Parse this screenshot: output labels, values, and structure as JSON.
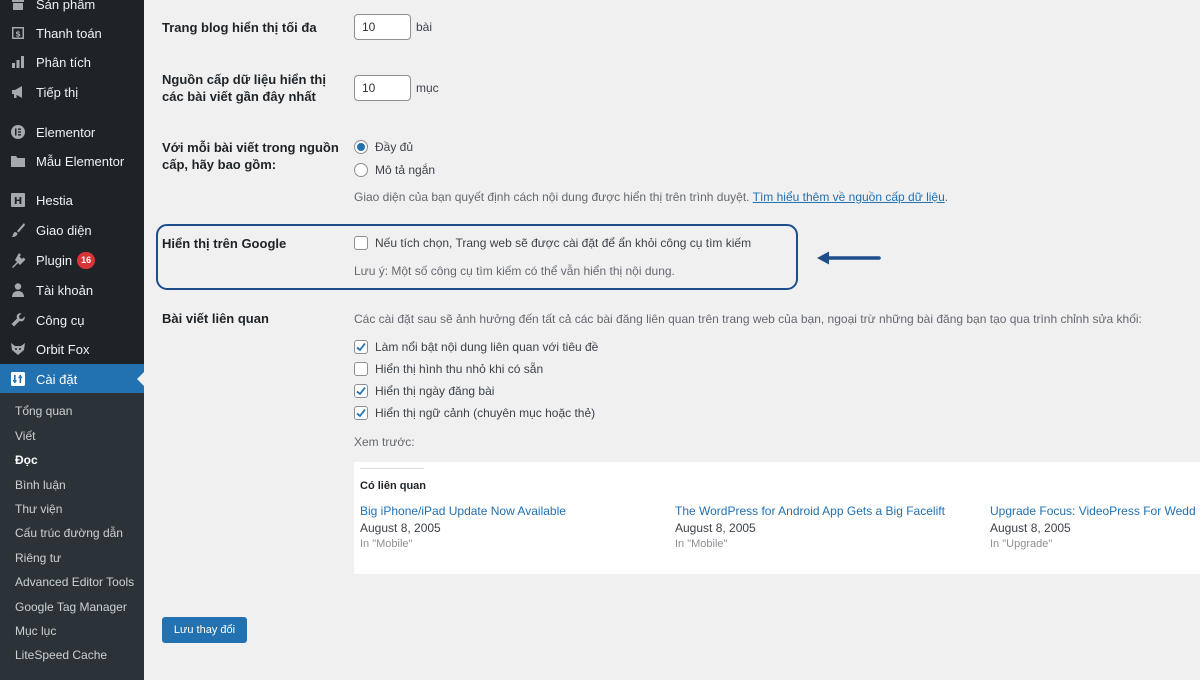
{
  "sidebar": {
    "items": [
      {
        "label": "Sản phẩm",
        "icon": "archive-icon"
      },
      {
        "label": "Thanh toán",
        "icon": "dollar-icon"
      },
      {
        "label": "Phân tích",
        "icon": "bar-chart-icon"
      },
      {
        "label": "Tiếp thị",
        "icon": "megaphone-icon"
      },
      {
        "label": "Elementor",
        "icon": "elementor-icon"
      },
      {
        "label": "Mẫu Elementor",
        "icon": "folder-icon"
      },
      {
        "label": "Hestia",
        "icon": "hestia-icon"
      },
      {
        "label": "Giao diện",
        "icon": "brush-icon"
      },
      {
        "label": "Plugin",
        "icon": "plugin-icon",
        "badge": "16"
      },
      {
        "label": "Tài khoản",
        "icon": "user-icon"
      },
      {
        "label": "Công cụ",
        "icon": "wrench-icon"
      },
      {
        "label": "Orbit Fox",
        "icon": "fox-icon"
      },
      {
        "label": "Cài đặt",
        "icon": "settings-icon",
        "active": true
      }
    ],
    "submenu": [
      "Tổng quan",
      "Viết",
      "Đọc",
      "Bình luận",
      "Thư viện",
      "Cấu trúc đường dẫn",
      "Riêng tư",
      "Advanced Editor Tools",
      "Google Tag Manager",
      "Mục lục",
      "LiteSpeed Cache"
    ],
    "submenu_current": "Đọc"
  },
  "settings": {
    "blog_pages": {
      "label": "Trang blog hiển thị tối đa",
      "value": "10",
      "unit": "bài"
    },
    "feed_posts": {
      "label_line1": "Nguồn cấp dữ liệu hiển thị",
      "label_line2": "các bài viết gần đây nhất",
      "value": "10",
      "unit": "mục"
    },
    "feed_content": {
      "label_line1": "Với mỗi bài viết trong nguồn",
      "label_line2": "cấp, hãy bao gồm:",
      "options": [
        "Đầy đủ",
        "Mô tả ngắn"
      ],
      "selected": "Đầy đủ",
      "description": "Giao diện của bạn quyết định cách nội dung được hiển thị trên trình duyệt.",
      "link_text": "Tìm hiểu thêm về nguồn cấp dữ liệu",
      "trailing": "."
    },
    "search_visibility": {
      "label": "Hiển thị trên Google",
      "checkbox_label": "Nếu tích chọn, Trang web sẽ được cài đặt để ẩn khỏi công cụ tìm kiếm",
      "checked": false,
      "note": "Lưu ý: Một số công cụ tìm kiếm có thể vẫn hiển thị nội dung."
    },
    "related_posts": {
      "label": "Bài viết liên quan",
      "intro": "Các cài đặt sau sẽ ảnh hưởng đến tất cả các bài đăng liên quan trên trang web của bạn, ngoại trừ những bài đăng bạn tạo qua trình chỉnh sửa khối:",
      "options": [
        {
          "label": "Làm nổi bật nội dung liên quan với tiêu đề",
          "checked": true
        },
        {
          "label": "Hiển thị hình thu nhỏ khi có sẵn",
          "checked": false
        },
        {
          "label": "Hiển thị ngày đăng bài",
          "checked": true
        },
        {
          "label": "Hiển thị ngữ cảnh (chuyên mục hoặc thẻ)",
          "checked": true
        }
      ],
      "preview_label": "Xem trước:",
      "preview": {
        "heading": "Có liên quan",
        "posts": [
          {
            "title": "Big iPhone/iPad Update Now Available",
            "date": "August 8, 2005",
            "category": "In \"Mobile\""
          },
          {
            "title": "The WordPress for Android App Gets a Big Facelift",
            "date": "August 8, 2005",
            "category": "In \"Mobile\""
          },
          {
            "title": "Upgrade Focus: VideoPress For Wedd",
            "date": "August 8, 2005",
            "category": "In \"Upgrade\""
          }
        ]
      }
    }
  },
  "save_button": "Lưu thay đổi",
  "colors": {
    "sidebar_bg": "#1d2327",
    "submenu_bg": "#2c3338",
    "accent": "#2271b1",
    "badge": "#d63638",
    "annotation": "#1e4d8c",
    "page_bg": "#f0f0f1"
  }
}
